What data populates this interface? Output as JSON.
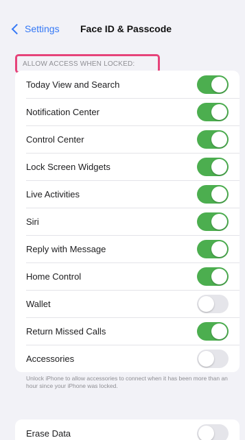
{
  "nav": {
    "back_label": "Settings",
    "title": "Face ID & Passcode"
  },
  "section": {
    "header": "ALLOW ACCESS WHEN LOCKED:",
    "highlight_color": "#e6437a"
  },
  "rows": [
    {
      "label": "Today View and Search",
      "on": true
    },
    {
      "label": "Notification Center",
      "on": true
    },
    {
      "label": "Control Center",
      "on": true
    },
    {
      "label": "Lock Screen Widgets",
      "on": true
    },
    {
      "label": "Live Activities",
      "on": true
    },
    {
      "label": "Siri",
      "on": true
    },
    {
      "label": "Reply with Message",
      "on": true
    },
    {
      "label": "Home Control",
      "on": true
    },
    {
      "label": "Wallet",
      "on": false
    },
    {
      "label": "Return Missed Calls",
      "on": true
    },
    {
      "label": "Accessories",
      "on": false
    }
  ],
  "footnote": "Unlock iPhone to allow accessories to connect when it has been more than an hour since your iPhone was locked.",
  "erase": {
    "label": "Erase Data",
    "on": false
  },
  "colors": {
    "toggle_on": "#4cae4f",
    "toggle_off": "#e5e5ea",
    "accent": "#3478f6"
  }
}
